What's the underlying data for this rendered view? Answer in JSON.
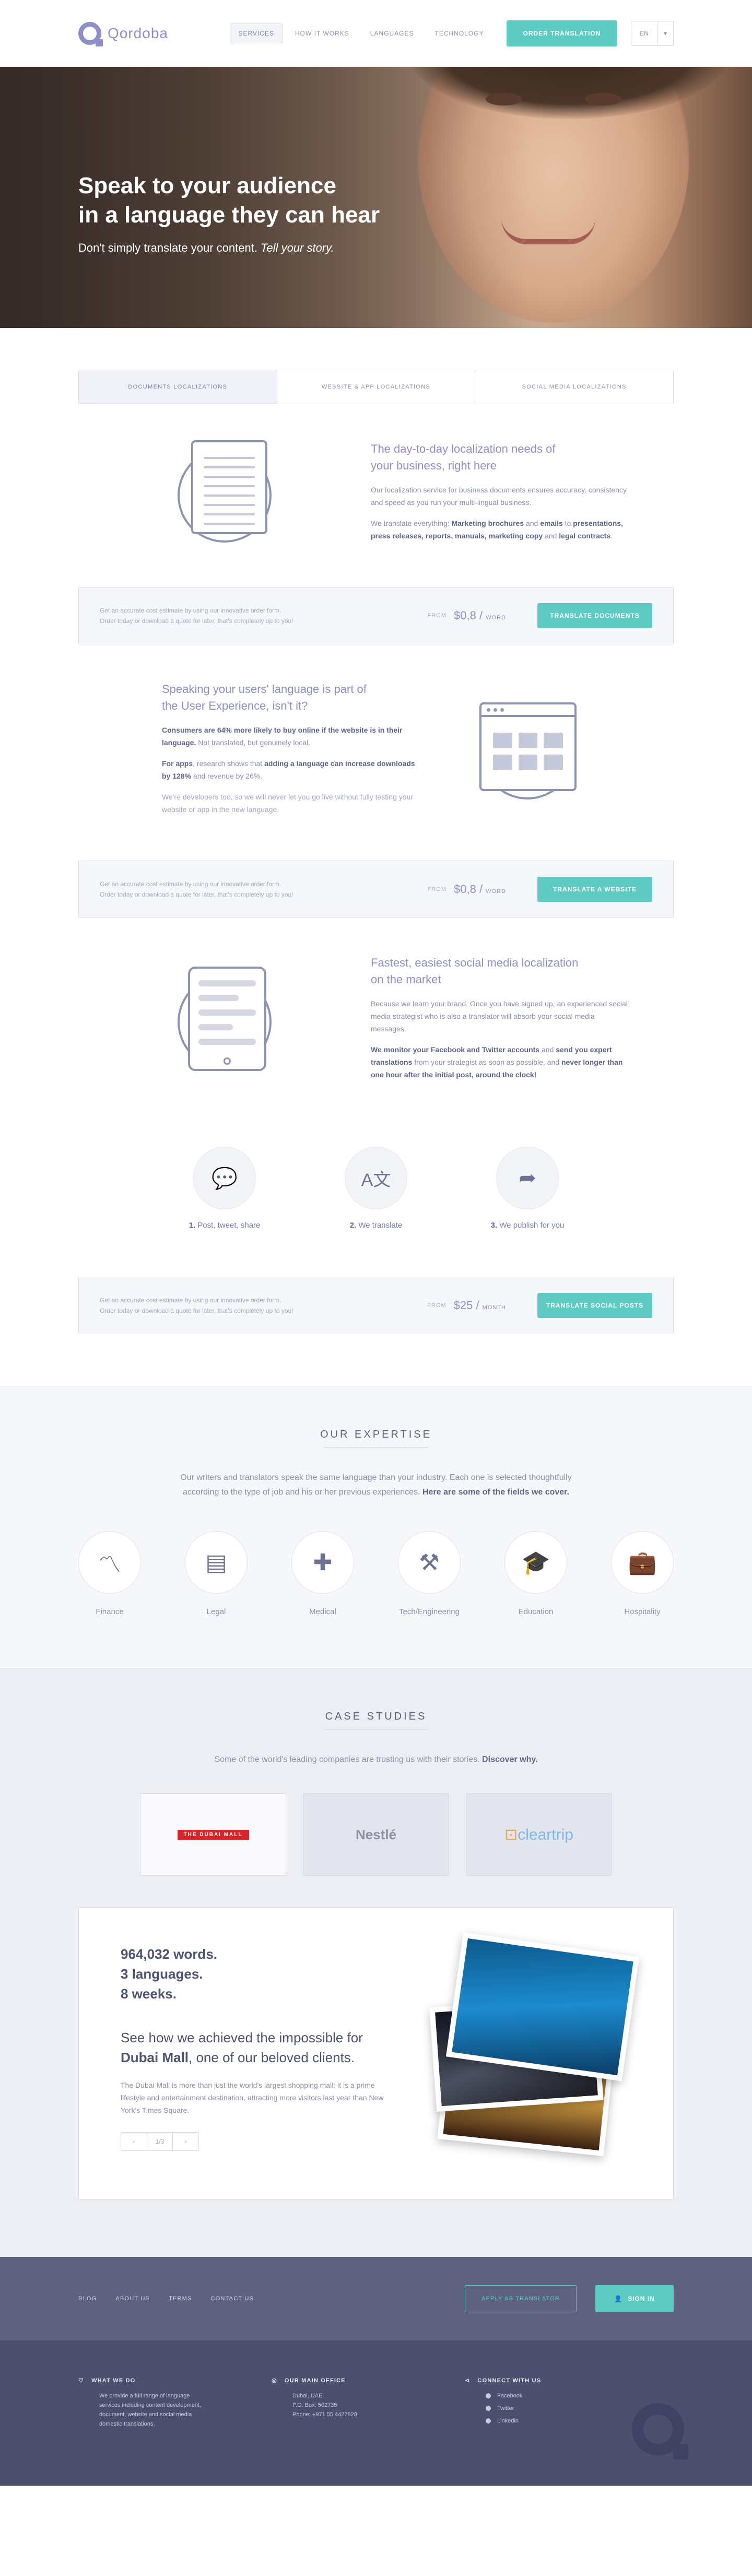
{
  "header": {
    "logo": "Qordoba",
    "nav": [
      "Services",
      "How it works",
      "Languages",
      "Technology"
    ],
    "order_button": "Order translation",
    "language": "EN",
    "language_caret": "▾"
  },
  "hero": {
    "title_line1": "Speak to your audience",
    "title_line2": "in a language they can hear",
    "subtitle_plain": "Don't simply translate your content. ",
    "subtitle_em": "Tell your story."
  },
  "tabs": [
    "Documents localizations",
    "Website & app localizations",
    "Social media localizations"
  ],
  "documents": {
    "title_line1": "The day-to-day localization needs of",
    "title_line2": "your business, right here",
    "p1": "Our localization service for business documents ensures accuracy, consistency and speed as you run your multi-lingual business.",
    "p2_a": "We translate everything: ",
    "p2_b": "Marketing brochures",
    "p2_c": " and ",
    "p2_d": "emails",
    "p2_e": " to ",
    "p2_f": "presentations, press releases, reports, manuals, marketing copy",
    "p2_g": " and ",
    "p2_h": "legal contracts",
    "p2_i": "."
  },
  "estimate_docs": {
    "note1": "Get an accurate cost estimate by using our innovative order form.",
    "note2": "Order today or download a quote for later, that's completely up to you!",
    "from": "FROM",
    "price": "$0,8 / ",
    "unit": "WORD",
    "button": "Translate documents"
  },
  "website": {
    "title_line1": "Speaking your users' language is part of",
    "title_line2": "the User Experience, isn't it?",
    "p1_a": "Consumers are 64% more likely to buy online if the website is in their language.",
    "p1_b": " Not translated, but genuinely local.",
    "p2_a": "For apps",
    "p2_b": ", research shows that ",
    "p2_c": "adding a language can increase downloads by 128%",
    "p2_d": " and revenue by 26%.",
    "p3": "We're developers too, so we will never let you go live without fully testing your website or app in the new language."
  },
  "estimate_web": {
    "note1": "Get an accurate cost estimate by using our innovative order form.",
    "note2": "Order today or download a quote for later, that's completely up to you!",
    "from": "FROM",
    "price": "$0,8 / ",
    "unit": "WORD",
    "button": "Translate a website"
  },
  "social": {
    "title_line1": "Fastest, easiest social media localization",
    "title_line2": "on the market",
    "p1": "Because we learn your brand. Once you have signed up, an experienced social media strategist who is also a translator will absorb your social media messages.",
    "p2_a": "We monitor your Facebook and Twitter accounts",
    "p2_b": " and ",
    "p2_c": "send you expert translations",
    "p2_d": " from your strategist as soon as possible, and ",
    "p2_e": "never longer than one hour after the initial post, around the clock!"
  },
  "steps": [
    {
      "num": "1.",
      "label": "Post, tweet, share",
      "icon": "chat-bubbles-icon"
    },
    {
      "num": "2.",
      "label": "We translate",
      "icon": "translate-icon"
    },
    {
      "num": "3.",
      "label": "We publish for you",
      "icon": "share-arrow-icon"
    }
  ],
  "estimate_social": {
    "note1": "Get an accurate cost estimate by using our innovative order form.",
    "note2": "Order today or download a quote for later, that's completely up to you!",
    "from": "FROM",
    "price": "$25 / ",
    "unit": "MONTH",
    "button": "Translate social posts"
  },
  "expertise": {
    "title": "OUR EXPERTISE",
    "intro_a": "Our writers and translators speak the same language than your industry. Each one is selected thoughtfully according to the type of job and his or her previous experiences. ",
    "intro_b": "Here are some of the fields we cover.",
    "fields": [
      {
        "label": "Finance",
        "icon": "chart-line-icon",
        "glyph": "〽"
      },
      {
        "label": "Legal",
        "icon": "document-icon",
        "glyph": "▤"
      },
      {
        "label": "Medical",
        "icon": "plus-icon",
        "glyph": "✚"
      },
      {
        "label": "Tech/Engineering",
        "icon": "tools-icon",
        "glyph": "⚒"
      },
      {
        "label": "Education",
        "icon": "graduation-cap-icon",
        "glyph": "🎓"
      },
      {
        "label": "Hospitality",
        "icon": "suitcase-icon",
        "glyph": "💼"
      }
    ]
  },
  "cases": {
    "title": "CASE STUDIES",
    "intro_a": "Some of the world's leading companies are trusting us with their stories. ",
    "intro_b": "Discover why.",
    "logos": {
      "dubai": "THE DUBAI MALL",
      "nestle": "Nestlé",
      "cleartrip_a": "⊡",
      "cleartrip_b": "cleartrip"
    },
    "stat1": "964,032 words.",
    "stat2": "3 languages.",
    "stat3": "8 weeks.",
    "headline_a": "See how we achieved the impossible for",
    "headline_b": "Dubai Mall",
    "headline_c": ", one of our beloved clients.",
    "body": "The Dubai Mall is more than just the world's largest shopping mall: it is a prime lifestyle and entertainment destination, attracting more visitors last year than New York's Times Square.",
    "pager_prev": "‹",
    "pager_count": "1/3",
    "pager_next": "›"
  },
  "footer": {
    "links": [
      "Blog",
      "About us",
      "Terms",
      "Contact us"
    ],
    "apply_button": "Apply as translator",
    "sign_in": "Sign in",
    "what_title": "What we do",
    "what_text": "We provide a full range of language services including content development, document, website and social media domestic translations.",
    "office_title": "Our main office",
    "office_l1": "Dubai, UAE",
    "office_l2": "P.O. Box: 502735",
    "office_l3": "Phone: +971 55 4427828",
    "connect_title": "Connect with us",
    "social": [
      "Facebook",
      "Twitter",
      "Linkedin"
    ]
  }
}
